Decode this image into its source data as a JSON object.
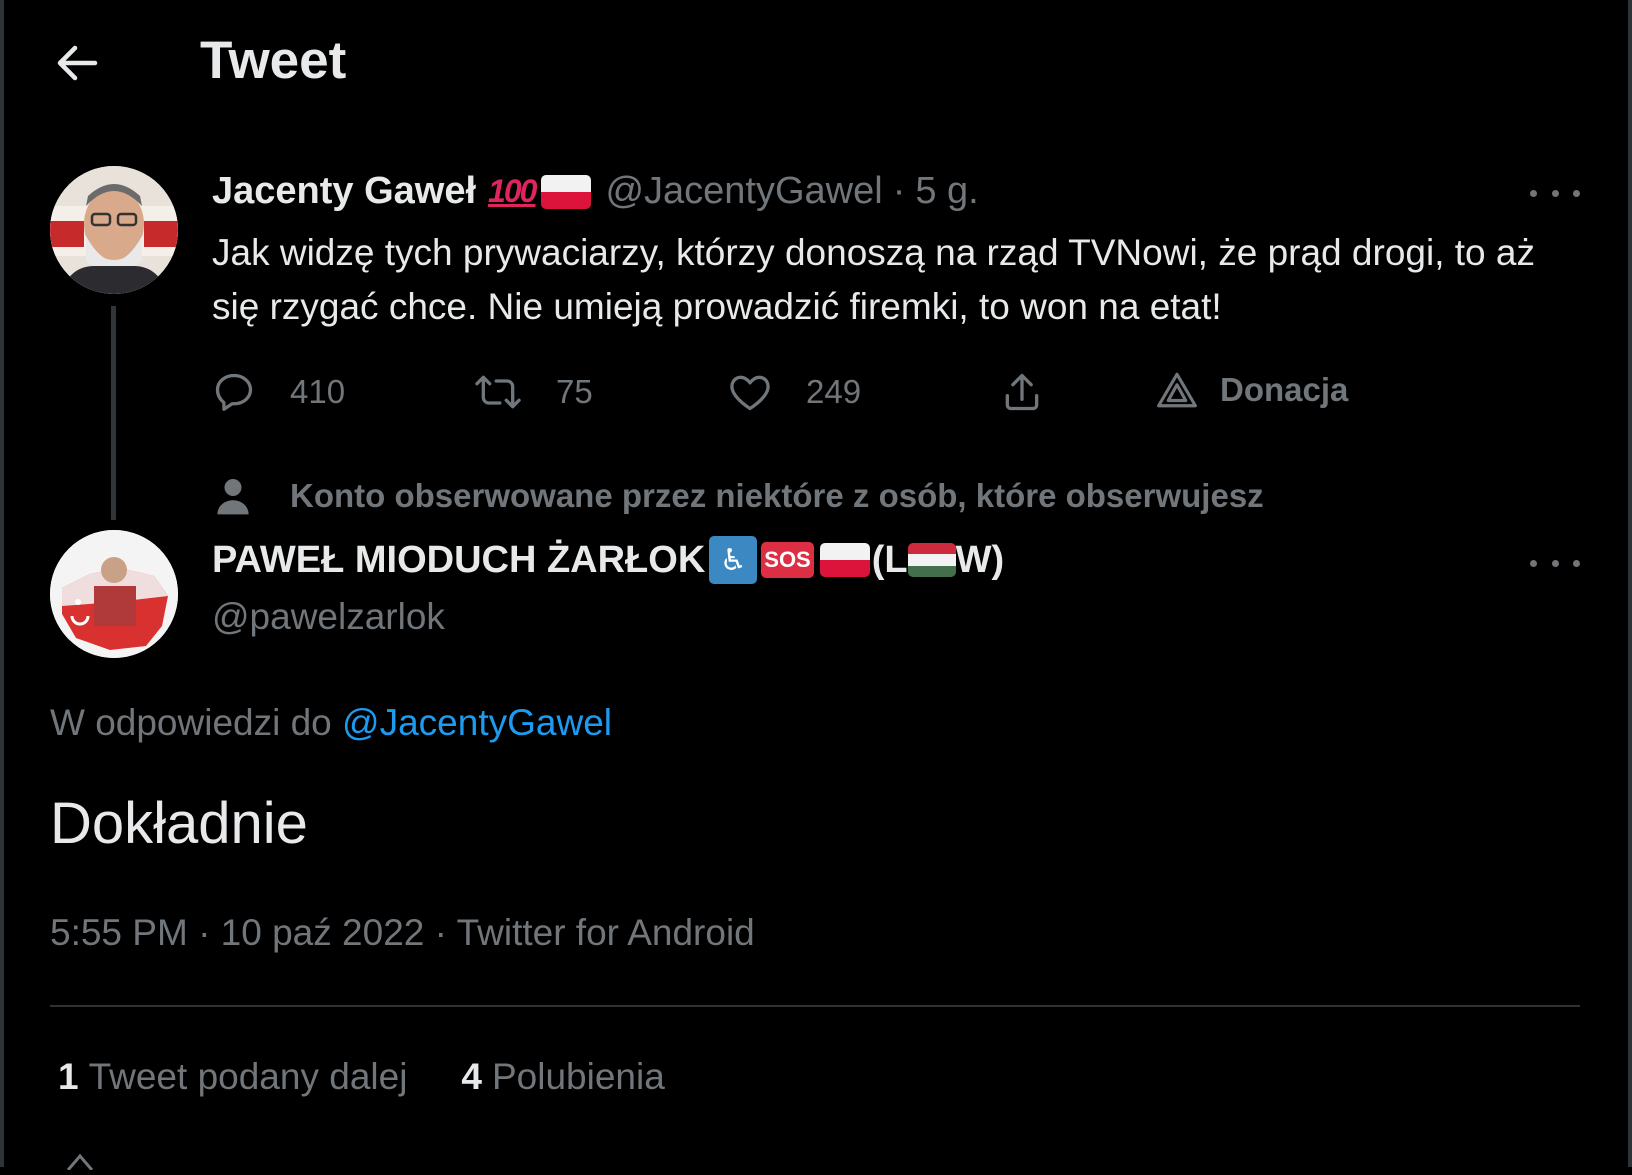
{
  "header": {
    "title": "Tweet"
  },
  "parent_tweet": {
    "name": "Jacenty Gaweł",
    "name_emoji": "💯",
    "handle": "@JacentyGawel",
    "separator": "·",
    "time": "5 g.",
    "text": "Jak widzę tych prywaciarzy, którzy donoszą na rząd TVNowi, że prąd drogi, to aż się rzygać chce. Nie umieją prowadzić firemki, to won na etat!",
    "actions": {
      "reply_count": "410",
      "retweet_count": "75",
      "like_count": "249",
      "donate_label": "Donacja"
    }
  },
  "social_context": "Konto obserwowane przez niektóre z osób, które obserwujesz",
  "main_tweet": {
    "name_text": "PAWEŁ MIODUCH ŻARŁOK",
    "name_open": "(L",
    "name_close": "W)",
    "sos_label": "SOS",
    "wheelchair": "♿",
    "handle": "@pawelzarlok",
    "replying_prefix": "W odpowiedzi do",
    "replying_handle": "@JacentyGawel",
    "text": "Dokładnie",
    "timestamp": "5:55 PM · 10 paź 2022 · Twitter for Android"
  },
  "stats": {
    "retweets_count": "1",
    "retweets_label": "Tweet podany dalej",
    "likes_count": "4",
    "likes_label": "Polubienia"
  },
  "colors": {
    "background": "#000000",
    "text": "#e7e9ea",
    "muted": "#71767b",
    "link": "#1d9bf0"
  }
}
